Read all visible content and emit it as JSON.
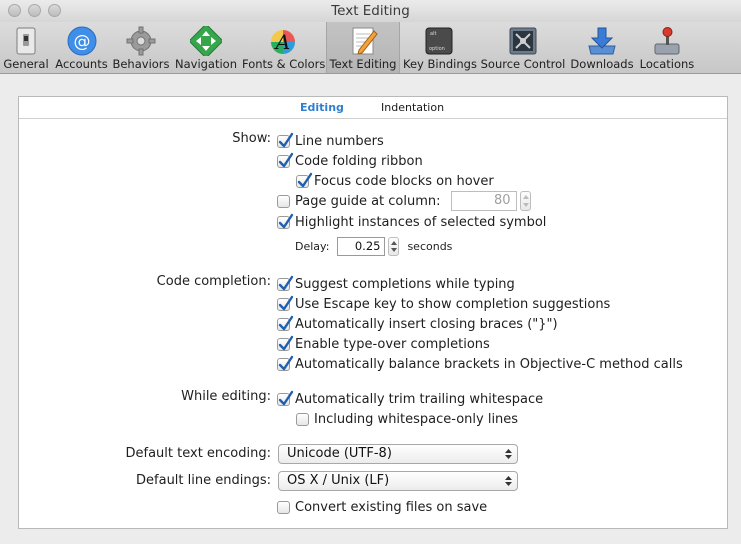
{
  "window": {
    "title": "Text Editing"
  },
  "toolbar": {
    "items": [
      {
        "label": "General",
        "icon": "switch-icon"
      },
      {
        "label": "Accounts",
        "icon": "at-icon"
      },
      {
        "label": "Behaviors",
        "icon": "gear-icon"
      },
      {
        "label": "Navigation",
        "icon": "arrows-icon"
      },
      {
        "label": "Fonts & Colors",
        "icon": "font-palette-icon"
      },
      {
        "label": "Text Editing",
        "icon": "pencil-paper-icon"
      },
      {
        "label": "Key Bindings",
        "icon": "option-key-icon"
      },
      {
        "label": "Source Control",
        "icon": "source-control-icon"
      },
      {
        "label": "Downloads",
        "icon": "download-icon"
      },
      {
        "label": "Locations",
        "icon": "joystick-icon"
      }
    ],
    "selected": "Text Editing"
  },
  "tabs": {
    "editing": "Editing",
    "indentation": "Indentation"
  },
  "show": {
    "label": "Show:",
    "line_numbers": "Line numbers",
    "code_folding": "Code folding ribbon",
    "focus_code": "Focus code blocks on hover",
    "page_guide": "Page guide at column:",
    "page_guide_value": "80",
    "highlight": "Highlight instances of selected symbol",
    "delay_label": "Delay:",
    "delay_value": "0.25",
    "delay_unit": "seconds"
  },
  "completion": {
    "label": "Code completion:",
    "suggest": "Suggest completions while typing",
    "escape": "Use Escape key to show completion suggestions",
    "braces": "Automatically insert closing braces (\"}\")",
    "typeover": "Enable type-over completions",
    "balance": "Automatically balance brackets in Objective-C method calls"
  },
  "editing": {
    "label": "While editing:",
    "trim": "Automatically trim trailing whitespace",
    "whitespace_only": "Including whitespace-only lines"
  },
  "encoding": {
    "label": "Default text encoding:",
    "value": "Unicode (UTF-8)"
  },
  "line_endings": {
    "label": "Default line endings:",
    "value": "OS X / Unix (LF)"
  },
  "convert": {
    "label": "Convert existing files on save"
  },
  "colors": {
    "accent": "#2f7fd1",
    "check": "#1f5fb0"
  }
}
